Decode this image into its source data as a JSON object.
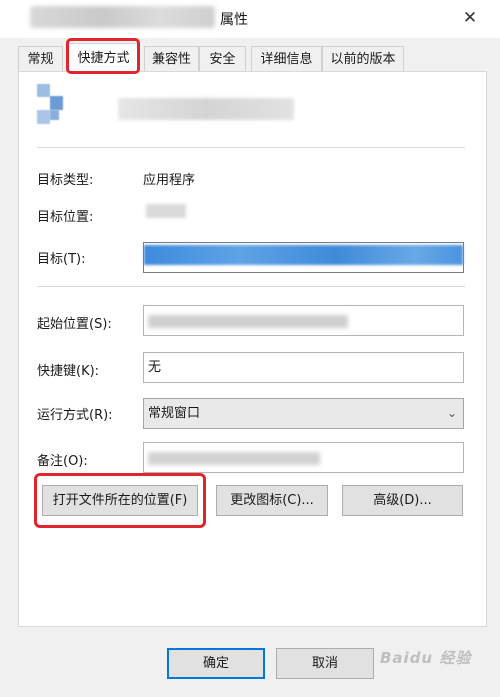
{
  "window": {
    "title": "属性",
    "close_glyph": "✕"
  },
  "tabs": [
    {
      "label": "常规",
      "active": false
    },
    {
      "label": "快捷方式",
      "active": true
    },
    {
      "label": "兼容性",
      "active": false
    },
    {
      "label": "安全",
      "active": false
    },
    {
      "label": "详细信息",
      "active": false
    },
    {
      "label": "以前的版本",
      "active": false
    }
  ],
  "shortcut": {
    "target_type_label": "目标类型:",
    "target_type_value": "应用程序",
    "target_location_label": "目标位置:",
    "target_label": "目标(T):",
    "start_in_label": "起始位置(S):",
    "hotkey_label": "快捷键(K):",
    "hotkey_value": "无",
    "run_label": "运行方式(R):",
    "run_value": "常规窗口",
    "comment_label": "备注(O):"
  },
  "buttons": {
    "open_location": "打开文件所在的位置(F)",
    "change_icon": "更改图标(C)...",
    "advanced": "高级(D)...",
    "ok": "确定",
    "cancel": "取消"
  },
  "watermark": "Baidu 经验",
  "colors": {
    "highlight": "#e0262c",
    "selection": "#3d8bdc",
    "default_button_border": "#0078d7"
  },
  "icons": {
    "close": "close-icon",
    "dropdown": "chevron-down-icon",
    "app": "app-icon"
  }
}
